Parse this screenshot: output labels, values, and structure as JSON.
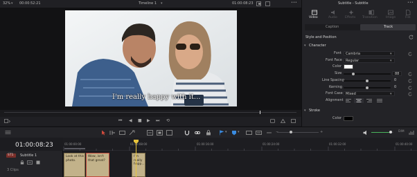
{
  "viewer": {
    "zoom": "32%",
    "source_timecode": "00:00:52:21",
    "timeline_name": "Timeline 1",
    "timeline_menu_icon": "chevron-down-icon",
    "record_timecode": "01:00:08:23",
    "subtitle_text": "I'm really happy with it..."
  },
  "inspector": {
    "title": "Subtitle - Subtitle",
    "tabs": [
      {
        "label": "Video",
        "icon": "video-icon"
      },
      {
        "label": "Audio",
        "icon": "audio-icon"
      },
      {
        "label": "Effects",
        "icon": "effects-icon"
      },
      {
        "label": "Transition",
        "icon": "transition-icon"
      },
      {
        "label": "Image",
        "icon": "image-icon"
      },
      {
        "label": "File",
        "icon": "file-icon"
      }
    ],
    "subtabs": [
      "Caption",
      "Track"
    ],
    "section_title": "Style and Position",
    "character_header": "Character",
    "props": {
      "font": {
        "label": "Font",
        "value": "Cambria"
      },
      "font_face": {
        "label": "Font Face",
        "value": "Regular"
      },
      "color": {
        "label": "Color"
      },
      "size": {
        "label": "Size",
        "value": "88"
      },
      "line_spacing": {
        "label": "Line Spacing",
        "value": "0"
      },
      "kerning": {
        "label": "Kerning",
        "value": "0"
      },
      "font_case": {
        "label": "Font Case",
        "value": "Mixed"
      },
      "alignment": {
        "label": "Alignment"
      }
    },
    "stroke_header": "Stroke",
    "stroke_color_label": "Color"
  },
  "timeline": {
    "timecode": "01:00:08:23",
    "ruler": [
      "01:00:00:00",
      "01:00:08:00",
      "01:00:16:00",
      "01:00:24:00",
      "01:00:32:00",
      "01:00:40:00"
    ],
    "track": {
      "id": "ST1",
      "name": "Subtitle 1",
      "clips_count": "3 Clips"
    },
    "clips": [
      {
        "text": "Look at this photo."
      },
      {
        "text": "Wow, isn't that great?"
      },
      {
        "text": "I'm really happ..."
      }
    ],
    "audio_level_label": "DIM"
  },
  "colors": {
    "accent_blue": "#3a8be0",
    "playhead_yellow": "#e8c43a",
    "clip_fill": "#c2b28a",
    "selected_clip_border": "#c0483a"
  }
}
